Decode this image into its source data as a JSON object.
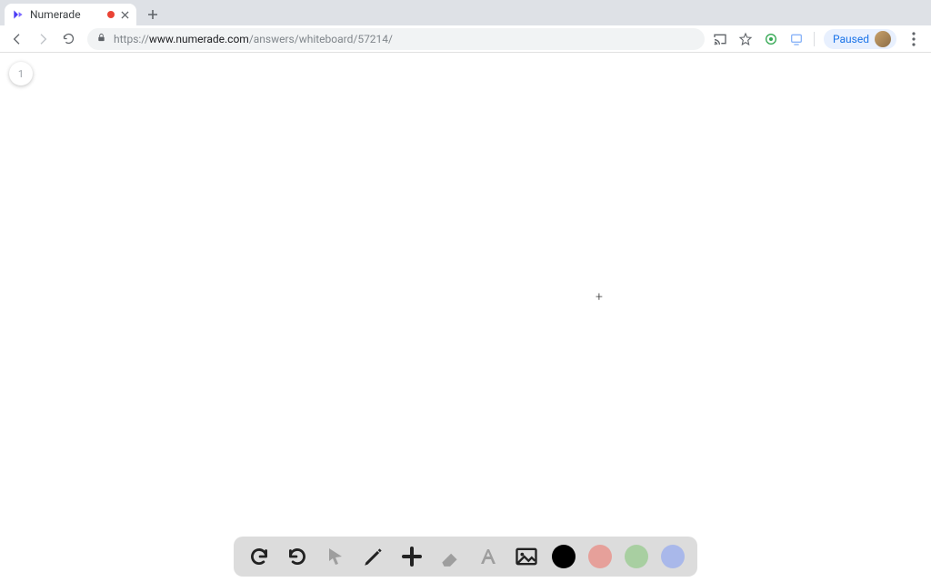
{
  "browser": {
    "tab": {
      "title": "Numerade",
      "recording": true
    },
    "url_prefix": "https://",
    "url_host": "www.numerade.com",
    "url_path": "/answers/whiteboard/57214/",
    "paused_label": "Paused"
  },
  "page": {
    "slide_number": "1"
  },
  "dock": {
    "colors": {
      "black": "#000000",
      "red": "#e6a09a",
      "green": "#a8cfa1",
      "blue": "#a9b8ea"
    }
  }
}
